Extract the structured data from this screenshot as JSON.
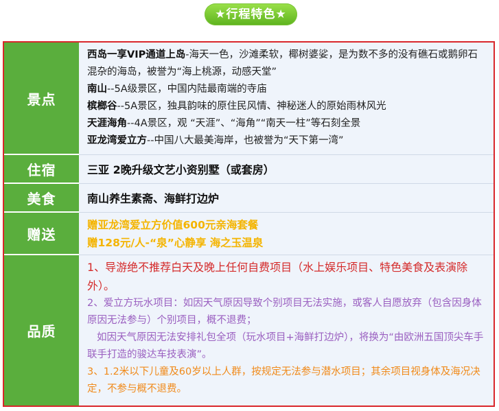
{
  "header": {
    "title": "★行程特色★"
  },
  "rows": {
    "spots": {
      "label": "景点",
      "items": [
        {
          "name": "西岛一享VIP通道上岛",
          "desc": "-海天一色，沙滩柔软，椰树婆娑，是为数不多的没有礁石或鹅卵石混杂的海岛，被誉为“海上桃源，动感天堂”"
        },
        {
          "name": "南山",
          "desc": "--5A级景区，中国内陆最南端的寺庙"
        },
        {
          "name": "槟榔谷",
          "desc": "--5A景区，独具韵味的原住民风情、神秘迷人的原始雨林风光"
        },
        {
          "name": "天涯海角",
          "desc": "--4A景区，观 “天涯”、“海角”“南天一柱”等石刻全景"
        },
        {
          "name": "亚龙湾爱立方",
          "desc": "--中国八大最美海岸，也被誉为“天下第一湾”"
        }
      ]
    },
    "stay": {
      "label": "住宿",
      "text": "三亚 2晚升级文艺小资别墅（或套房）"
    },
    "food": {
      "label": "美食",
      "text": "南山养生素斋、海鲜打边炉"
    },
    "gift": {
      "label": "赠送",
      "lines": [
        "赠亚龙湾爱立方价值600元亲海套餐",
        "赠128元/人-“泉”心静享 海之玉温泉"
      ]
    },
    "quality": {
      "label": "品质",
      "q1": "1、导游绝不推荐白天及晚上任何自费项目（水上娱乐项目、特色美食及表演除外）。",
      "q2a": "2、爱立方玩水项目：如因天气原因导致个别项目无法实施，或客人自愿放弃（包含因身体原因无法参与）个别项目，概不退费；",
      "q2b": "如因天气原因无法安排礼包全项（玩水项目+海鲜打边炉），将换为“由欧洲五国顶尖车手联手打造的骏达车技表演”。",
      "q3": "3、1.2米以下儿童及60岁以上人群，按规定无法参与潜水项目；其余项目视身体及海况决定，不参与概不退费。"
    }
  },
  "colors": {
    "label_bg": "#5aae3d",
    "border": "#d9262b",
    "gift_text": "#f4b400",
    "q1_text": "#d42a2a",
    "q2_text": "#9a5fc0",
    "q3_text": "#f08a1a"
  }
}
